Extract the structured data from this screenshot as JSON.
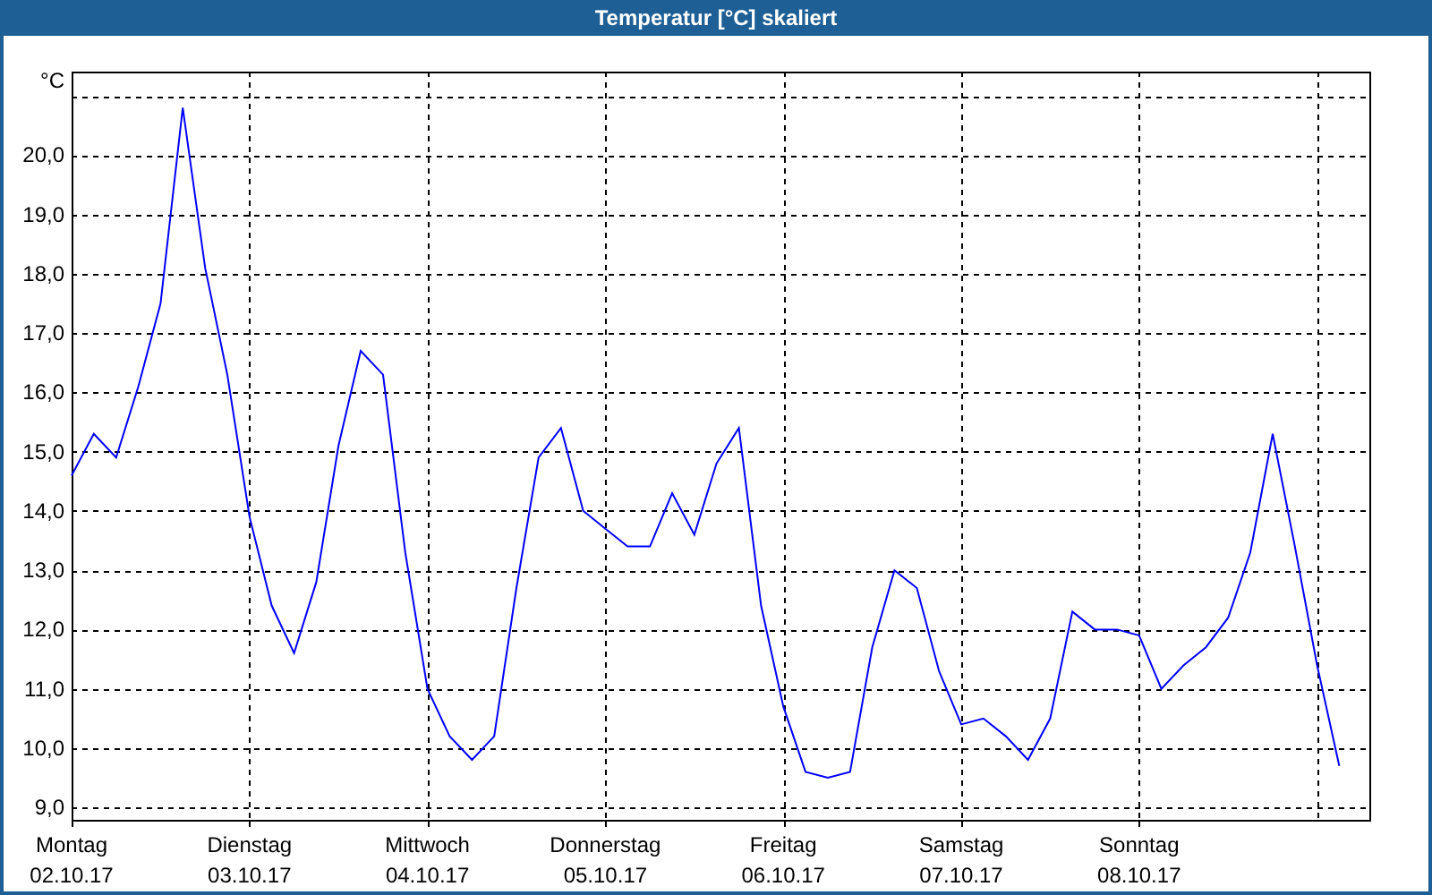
{
  "window": {
    "title": "Temperatur [°C] skaliert"
  },
  "chart": {
    "chart_data": {
      "type": "line",
      "grid": true,
      "ylabel": "°C",
      "ylim": [
        8.79,
        21.41
      ],
      "yticks": [
        {
          "value": 9,
          "label": "9,0"
        },
        {
          "value": 10,
          "label": "10,0"
        },
        {
          "value": 11,
          "label": "11,0"
        },
        {
          "value": 12,
          "label": "12,0"
        },
        {
          "value": 13,
          "label": "13,0"
        },
        {
          "value": 14,
          "label": "14,0"
        },
        {
          "value": 15,
          "label": "15,0"
        },
        {
          "value": 16,
          "label": "16,0"
        },
        {
          "value": 17,
          "label": "17,0"
        },
        {
          "value": 18,
          "label": "18,0"
        },
        {
          "value": 19,
          "label": "19,0"
        },
        {
          "value": 20,
          "label": "20,0"
        }
      ],
      "categories": [
        "Montag 02.10.17",
        null,
        null,
        null,
        null,
        null,
        null,
        null,
        "Dienstag 03.10.17",
        null,
        null,
        null,
        null,
        null,
        null,
        null,
        "Mittwoch 04.10.17",
        null,
        null,
        null,
        null,
        null,
        null,
        null,
        "Donnerstag 05.10.17",
        null,
        null,
        null,
        null,
        null,
        null,
        null,
        "Freitag 06.10.17",
        null,
        null,
        null,
        null,
        null,
        null,
        null,
        "Samstag 07.10.17",
        null,
        null,
        null,
        null,
        null,
        null,
        null,
        "Sonntag 08.10.17",
        null,
        null,
        null,
        null,
        null,
        null,
        null,
        null,
        null
      ],
      "series": [
        {
          "color": "#0000ff",
          "values": [
            14.6,
            15.3,
            14.9,
            16.1,
            17.5,
            20.8,
            18.1,
            16.3,
            13.9,
            12.4,
            11.6,
            12.8,
            15.1,
            16.7,
            16.3,
            13.3,
            11.0,
            10.2,
            9.8,
            10.2,
            12.7,
            14.9,
            15.4,
            14.0,
            13.7,
            13.4,
            13.4,
            14.3,
            13.6,
            14.8,
            15.4,
            12.4,
            10.7,
            9.6,
            9.5,
            9.6,
            11.7,
            13.0,
            12.7,
            11.3,
            10.4,
            10.5,
            10.2,
            9.8,
            10.5,
            12.3,
            12.0,
            12.0,
            11.9,
            11.0,
            11.4,
            11.7,
            12.2,
            13.3,
            15.3,
            13.4,
            11.4,
            9.7
          ]
        }
      ]
    }
  }
}
